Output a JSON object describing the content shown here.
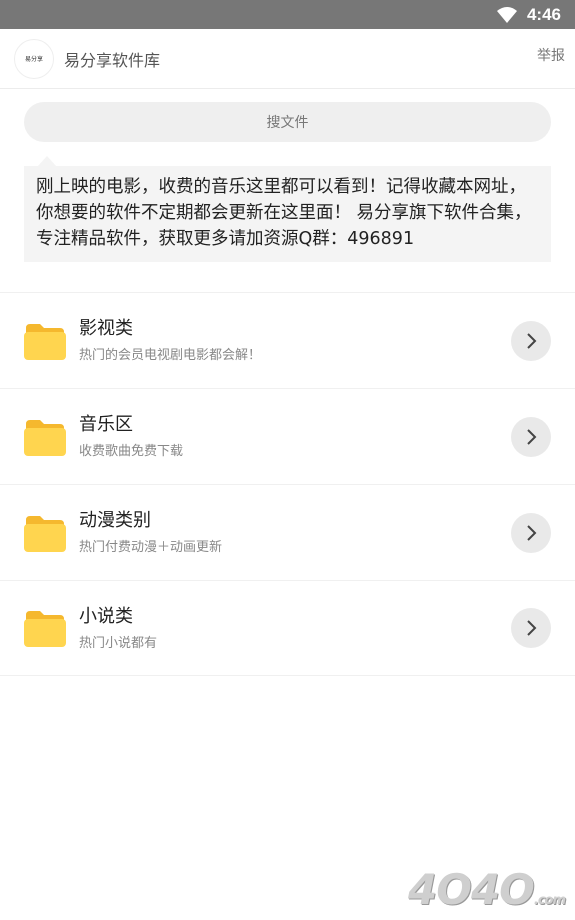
{
  "status_bar": {
    "time": "4:46"
  },
  "header": {
    "logo_text": "易分享",
    "title": "易分享软件库",
    "report_label": "举报"
  },
  "search": {
    "placeholder": "搜文件"
  },
  "notice": {
    "text": "刚上映的电影，收费的音乐这里都可以看到！记得收藏本网址，你想要的软件不定期都会更新在这里面！ 易分享旗下软件合集，专注精品软件，获取更多请加资源Q群：496891"
  },
  "categories": [
    {
      "title": "影视类",
      "desc": "热门的会员电视剧电影都会解！"
    },
    {
      "title": "音乐区",
      "desc": "收费歌曲免费下载"
    },
    {
      "title": "动漫类别",
      "desc": "热门付费动漫＋动画更新"
    },
    {
      "title": "小说类",
      "desc": "热门小说都有"
    }
  ],
  "watermark": {
    "text": "4O4O",
    "suffix": ".com"
  },
  "colors": {
    "folder": "#FFD54F",
    "folder_dark": "#F5B82E",
    "status_bar": "#777777"
  }
}
